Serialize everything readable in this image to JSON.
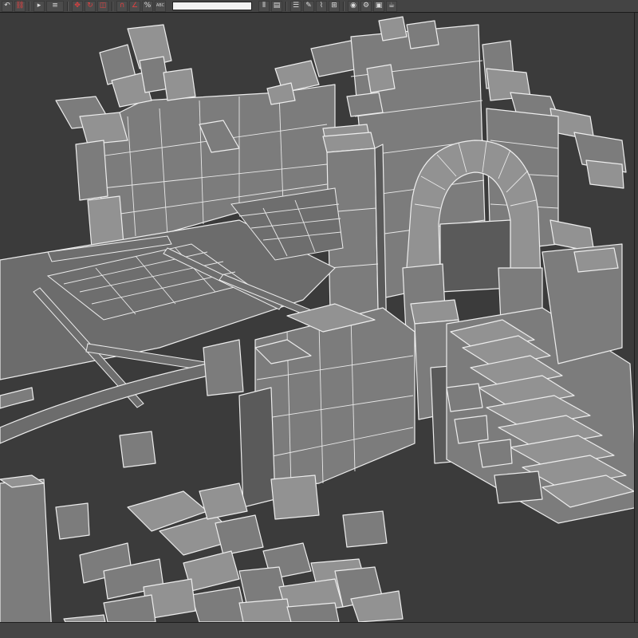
{
  "toolbar": {
    "named_selection_value": "",
    "buttons": [
      {
        "name": "select-object-icon",
        "glyph": "▸"
      },
      {
        "name": "select-move-icon",
        "glyph": "✥"
      },
      {
        "name": "select-rotate-icon",
        "glyph": "↻"
      },
      {
        "name": "select-scale-icon",
        "glyph": "◫"
      },
      {
        "name": "snap-toggle-icon",
        "glyph": "∩"
      },
      {
        "name": "angle-snap-icon",
        "glyph": "∠"
      },
      {
        "name": "percent-snap-icon",
        "glyph": "%"
      },
      {
        "name": "spinner-snap-icon",
        "glyph": "⇕"
      }
    ],
    "abc_label": "ABC"
  },
  "viewport": {
    "label": ""
  },
  "colors": {
    "background": "#3b3b3b",
    "mesh_fill": "#7c7c7c",
    "wireframe": "#ededed",
    "toolbar": "#444444"
  }
}
